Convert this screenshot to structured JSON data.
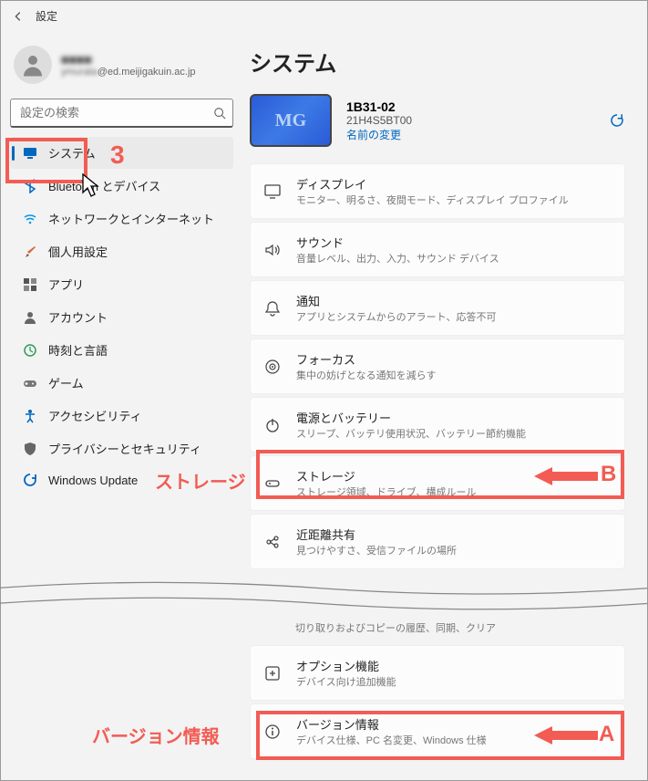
{
  "titlebar": {
    "title": "設定"
  },
  "user": {
    "name": "■■■■",
    "email": "@ed.meijigakuin.ac.jp",
    "email_prefix": "ymurata"
  },
  "search": {
    "placeholder": "設定の検索"
  },
  "nav": {
    "items": [
      {
        "label": "システム",
        "icon": "monitor-icon",
        "color": "#0067c0",
        "active": true
      },
      {
        "label": "Bluetooth とデバイス",
        "icon": "bluetooth-icon",
        "color": "#0067c0"
      },
      {
        "label": "ネットワークとインターネット",
        "icon": "wifi-icon",
        "color": "#0099e5"
      },
      {
        "label": "個人用設定",
        "icon": "brush-icon",
        "color": "#d46a3a"
      },
      {
        "label": "アプリ",
        "icon": "apps-icon",
        "color": "#555"
      },
      {
        "label": "アカウント",
        "icon": "person-icon",
        "color": "#555"
      },
      {
        "label": "時刻と言語",
        "icon": "globe-time-icon",
        "color": "#2a9d58"
      },
      {
        "label": "ゲーム",
        "icon": "game-icon",
        "color": "#777"
      },
      {
        "label": "アクセシビリティ",
        "icon": "accessibility-icon",
        "color": "#0067c0"
      },
      {
        "label": "プライバシーとセキュリティ",
        "icon": "shield-icon",
        "color": "#555"
      },
      {
        "label": "Windows Update",
        "icon": "update-icon",
        "color": "#0067c0"
      }
    ]
  },
  "page": {
    "title": "システム"
  },
  "device": {
    "name": "1B31-02",
    "serial": "21H4S5BT00",
    "rename": "名前の変更"
  },
  "settings": [
    {
      "title": "ディスプレイ",
      "desc": "モニター、明るさ、夜間モード、ディスプレイ プロファイル",
      "icon": "display-icon"
    },
    {
      "title": "サウンド",
      "desc": "音量レベル、出力、入力、サウンド デバイス",
      "icon": "sound-icon"
    },
    {
      "title": "通知",
      "desc": "アプリとシステムからのアラート、応答不可",
      "icon": "bell-icon"
    },
    {
      "title": "フォーカス",
      "desc": "集中の妨げとなる通知を減らす",
      "icon": "focus-icon"
    },
    {
      "title": "電源とバッテリー",
      "desc": "スリープ、バッテリ使用状況、バッテリー節約機能",
      "icon": "power-icon"
    },
    {
      "title": "ストレージ",
      "desc": "ストレージ領域、ドライブ、構成ルール",
      "icon": "storage-icon"
    },
    {
      "title": "近距離共有",
      "desc": "見つけやすさ、受信ファイルの場所",
      "icon": "share-icon"
    }
  ],
  "settings2_partial": {
    "desc": "切り取りおよびコピーの履歴、同期、クリア"
  },
  "settings2": [
    {
      "title": "オプション機能",
      "desc": "デバイス向け追加機能",
      "icon": "plus-box-icon"
    },
    {
      "title": "バージョン情報",
      "desc": "デバイス仕様、PC 名変更、Windows 仕様",
      "icon": "info-icon"
    }
  ],
  "annotations": {
    "three": "3",
    "A": "A",
    "B": "B",
    "storage": "ストレージ",
    "version": "バージョン情報"
  },
  "colors": {
    "accent": "#0067c0",
    "annot": "#f25c54"
  }
}
